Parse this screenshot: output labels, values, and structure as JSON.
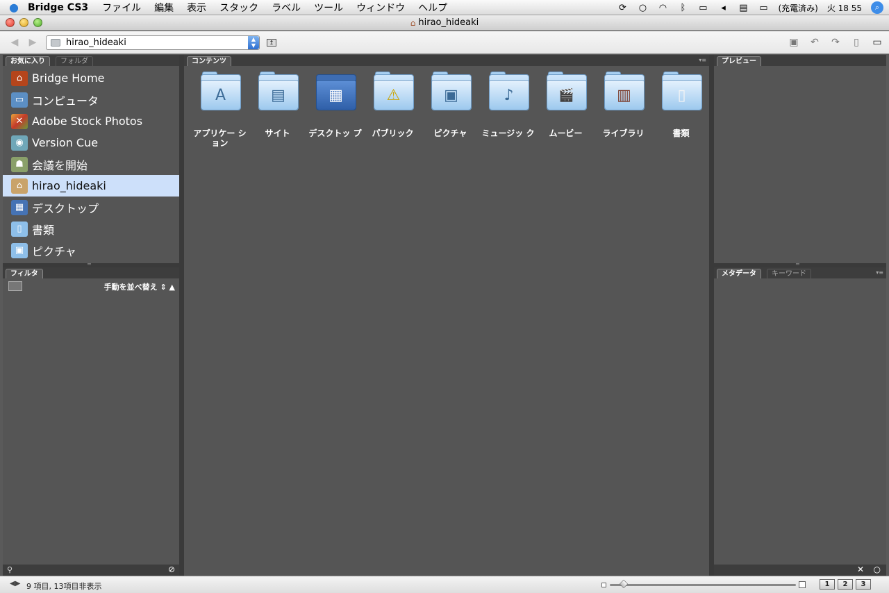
{
  "menubar": {
    "app_name": "Bridge CS3",
    "menus": [
      "ファイル",
      "編集",
      "表示",
      "スタック",
      "ラベル",
      "ツール",
      "ウィンドウ",
      "ヘルプ"
    ],
    "battery_status": "(充電済み)",
    "clock": "火 18 55"
  },
  "window": {
    "title": "hirao_hideaki"
  },
  "toolbar": {
    "path_value": "hirao_hideaki"
  },
  "favorites_panel": {
    "tabs": [
      "お気に入り",
      "フォルダ"
    ],
    "items": [
      {
        "label": "Bridge Home",
        "icon": "bridge-home-icon",
        "color": "#b5451b"
      },
      {
        "label": "コンピュータ",
        "icon": "computer-icon",
        "color": "#5c8fc4"
      },
      {
        "label": "Adobe Stock Photos",
        "icon": "stock-photos-icon",
        "color": "#d44a2a"
      },
      {
        "label": "Version Cue",
        "icon": "version-cue-icon",
        "color": "#6fa7b8"
      },
      {
        "label": "会議を開始",
        "icon": "meeting-icon",
        "color": "#8aa06a"
      },
      {
        "label": "hirao_hideaki",
        "icon": "home-folder-icon",
        "color": "#c9a36a"
      },
      {
        "label": "デスクトップ",
        "icon": "desktop-icon",
        "color": "#4673b4"
      },
      {
        "label": "書類",
        "icon": "documents-folder-icon",
        "color": "#8ebfe9"
      },
      {
        "label": "ピクチャ",
        "icon": "pictures-folder-icon",
        "color": "#8ebfe9"
      }
    ],
    "selected_index": 5
  },
  "filter_panel": {
    "tab": "フィルタ",
    "sort_label": "手動を並べ替え"
  },
  "content_panel": {
    "tab": "コンテンツ",
    "items": [
      {
        "name": "アプリケー ション",
        "icon": "applications-folder-icon",
        "glyph": "A"
      },
      {
        "name": "サイト",
        "icon": "sites-folder-icon",
        "glyph": "▤"
      },
      {
        "name": "デスクトッ プ",
        "icon": "desktop-folder-icon",
        "glyph": "▦"
      },
      {
        "name": "パブリック",
        "icon": "public-folder-icon",
        "glyph": "⚠"
      },
      {
        "name": "ピクチャ",
        "icon": "pictures-folder-icon",
        "glyph": "▣"
      },
      {
        "name": "ミュージッ ク",
        "icon": "music-folder-icon",
        "glyph": "♪"
      },
      {
        "name": "ムービー",
        "icon": "movies-folder-icon",
        "glyph": "🎬"
      },
      {
        "name": "ライブラリ",
        "icon": "library-folder-icon",
        "glyph": "▥"
      },
      {
        "name": "書類",
        "icon": "documents-folder-icon",
        "glyph": "▯"
      }
    ]
  },
  "preview_panel": {
    "tab": "プレビュー"
  },
  "metadata_panel": {
    "tabs": [
      "メタデータ",
      "キーワード"
    ]
  },
  "statusbar": {
    "text": "9 項目, 13項目非表示",
    "view_buttons": [
      "1",
      "2",
      "3"
    ],
    "thumbnail_size": 0.06
  }
}
